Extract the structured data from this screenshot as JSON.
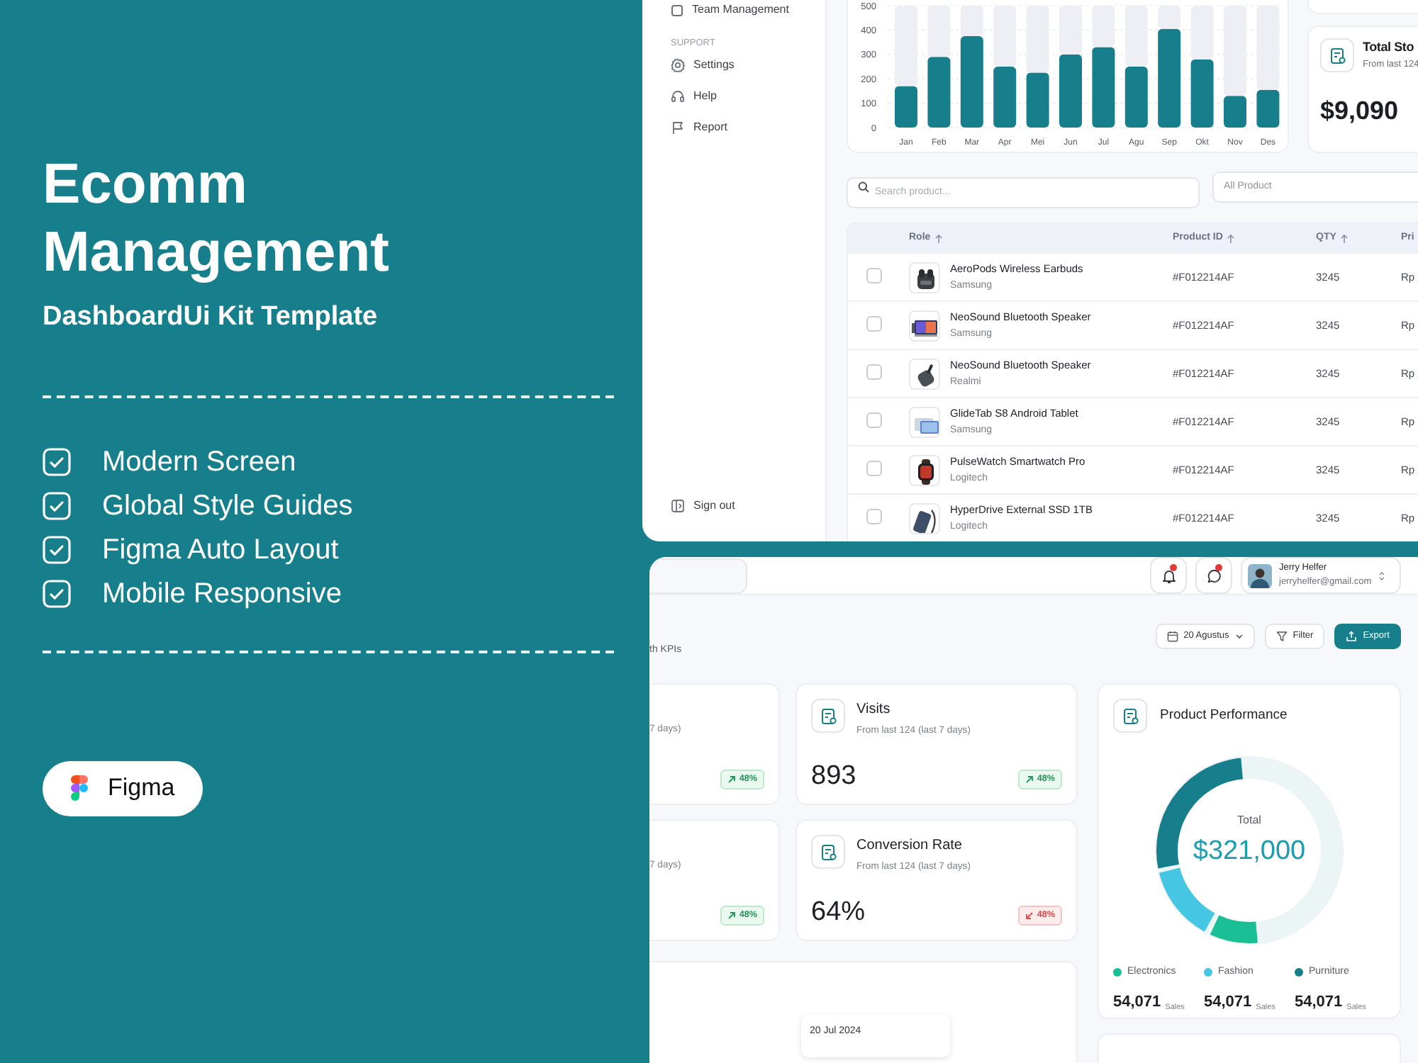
{
  "promo": {
    "title": "Ecomm Management",
    "subtitle": "DashboardUi Kit Template",
    "features": [
      {
        "label": "Modern Screen",
        "checked": true
      },
      {
        "label": "Global Style Guides",
        "checked": true
      },
      {
        "label": "Figma Auto Layout",
        "checked": true
      },
      {
        "label": "Mobile Responsive",
        "checked": true
      }
    ],
    "tool_badge": "Figma"
  },
  "screen_top": {
    "sidebar": {
      "cut_item": "Team Management",
      "section": "SUPPORT",
      "items": [
        {
          "label": "Settings"
        },
        {
          "label": "Help"
        },
        {
          "label": "Report"
        }
      ],
      "sign_out": "Sign out"
    },
    "sales_chart": {
      "chart_data": {
        "type": "bar",
        "categories": [
          "Jan",
          "Feb",
          "Mar",
          "Apr",
          "Mei",
          "Jun",
          "Jul",
          "Agu",
          "Sep",
          "Okt",
          "Nov",
          "Des"
        ],
        "stacked": true,
        "series": [
          {
            "color": "#177f8c",
            "values": [
              170,
              290,
              375,
              250,
              225,
              300,
              330,
              250,
              405,
              280,
              130,
              155
            ]
          },
          {
            "color": "#eeeff4",
            "values": [
              330,
              210,
              125,
              250,
              275,
              200,
              170,
              250,
              95,
              220,
              370,
              345
            ]
          }
        ],
        "ylim": [
          0,
          500
        ],
        "yticks": [
          0,
          100,
          200,
          300,
          400,
          500
        ],
        "grid": true
      }
    },
    "stock_card": {
      "title": "Total Sto",
      "subtitle": "From last 124",
      "value": "$9,090"
    },
    "search": {
      "placeholder": "Search product..."
    },
    "product_filter": {
      "value": "All Product"
    },
    "table": {
      "columns": [
        {
          "label": "Role",
          "sortable": true
        },
        {
          "label": "Product ID",
          "sortable": true
        },
        {
          "label": "QTY",
          "sortable": true
        },
        {
          "label": "Pri"
        }
      ],
      "rows": [
        {
          "checked": false,
          "name": "AeroPods Wireless Earbuds",
          "brand": "Samsung",
          "product_id": "#F012214AF",
          "qty": "3245",
          "column_4": "Rp"
        },
        {
          "checked": false,
          "name": "NeoSound Bluetooth Speaker",
          "brand": "Samsung",
          "product_id": "#F012214AF",
          "qty": "3245",
          "column_4": "Rp"
        },
        {
          "checked": false,
          "name": "NeoSound Bluetooth Speaker",
          "brand": "Realmi",
          "product_id": "#F012214AF",
          "qty": "3245",
          "column_4": "Rp"
        },
        {
          "checked": false,
          "name": "GlideTab S8 Android Tablet",
          "brand": "Samsung",
          "product_id": "#F012214AF",
          "qty": "3245",
          "column_4": "Rp"
        },
        {
          "checked": false,
          "name": "PulseWatch Smartwatch Pro",
          "brand": "Logitech",
          "product_id": "#F012214AF",
          "qty": "3245",
          "column_4": "Rp"
        },
        {
          "checked": false,
          "name": "HyperDrive External SSD 1TB",
          "brand": "Logitech",
          "product_id": "#F012214AF",
          "qty": "3245",
          "column_4": "Rp"
        }
      ]
    }
  },
  "screen_bottom": {
    "notifications": {
      "unread": true
    },
    "messages": {
      "unread": true
    },
    "user": {
      "name": "Jerry Helfer",
      "email": "jerryhelfer@gmail.com"
    },
    "subtitle": "th KPIs",
    "date_button": "20 Agustus",
    "filter_button": "Filter",
    "export_button": "Export",
    "kpis": [
      {
        "subtitle": "7 days)",
        "rising": true,
        "change": "48%"
      },
      {
        "title": "Visits",
        "subtitle": "From last 124 (last 7 days)",
        "value": "893",
        "rising": true,
        "change": "48%"
      },
      {
        "subtitle": "7 days)",
        "rising": true,
        "change": "48%"
      },
      {
        "title": "Conversion Rate",
        "subtitle": "From last 124 (last 7 days)",
        "value": "64%",
        "rising": false,
        "change": "48%"
      }
    ],
    "chart_card": {
      "tooltip": "20 Jul 2024"
    },
    "performance": {
      "title": "Product Performance",
      "total_label": "Total",
      "total": "$321,000",
      "legend": [
        {
          "label": "Electronics",
          "color": "#1bbf95",
          "value": "54,071",
          "unit": "Sales"
        },
        {
          "label": "Fashion",
          "color": "#45c6e2",
          "value": "54,071",
          "unit": "Sales"
        },
        {
          "label": "Purniture",
          "color": "#177f8c",
          "value": "54,071",
          "unit": "Sales"
        }
      ]
    }
  }
}
